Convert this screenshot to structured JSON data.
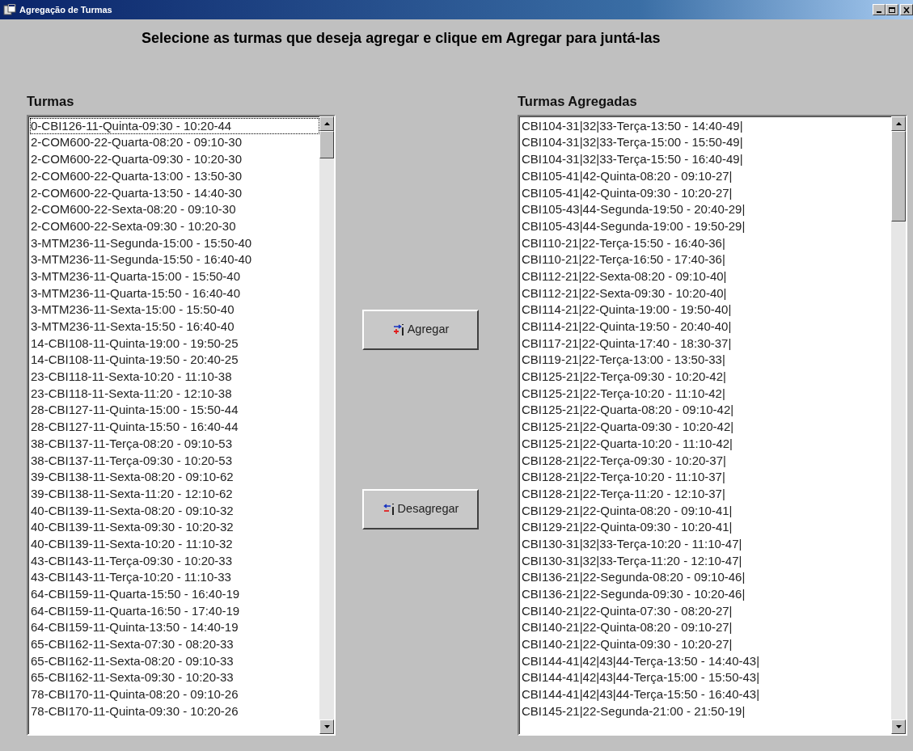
{
  "window": {
    "title": "Agregação de Turmas"
  },
  "instruction": "Selecione as turmas que deseja agregar e clique em Agregar para juntá-las",
  "turmas": {
    "label": "Turmas",
    "items": [
      {
        "text": "0-CBI126-11-Quinta-09:30 - 10:20-44",
        "focused": true
      },
      {
        "text": "2-COM600-22-Quarta-08:20 - 09:10-30",
        "focused": false
      },
      {
        "text": "2-COM600-22-Quarta-09:30 - 10:20-30",
        "focused": false
      },
      {
        "text": "2-COM600-22-Quarta-13:00 - 13:50-30",
        "focused": false
      },
      {
        "text": "2-COM600-22-Quarta-13:50 - 14:40-30",
        "focused": false
      },
      {
        "text": "2-COM600-22-Sexta-08:20 - 09:10-30",
        "focused": false
      },
      {
        "text": "2-COM600-22-Sexta-09:30 - 10:20-30",
        "focused": false
      },
      {
        "text": "3-MTM236-11-Segunda-15:00 - 15:50-40",
        "focused": false
      },
      {
        "text": "3-MTM236-11-Segunda-15:50 - 16:40-40",
        "focused": false
      },
      {
        "text": "3-MTM236-11-Quarta-15:00 - 15:50-40",
        "focused": false
      },
      {
        "text": "3-MTM236-11-Quarta-15:50 - 16:40-40",
        "focused": false
      },
      {
        "text": "3-MTM236-11-Sexta-15:00 - 15:50-40",
        "focused": false
      },
      {
        "text": "3-MTM236-11-Sexta-15:50 - 16:40-40",
        "focused": false
      },
      {
        "text": "14-CBI108-11-Quinta-19:00 - 19:50-25",
        "focused": false
      },
      {
        "text": "14-CBI108-11-Quinta-19:50 - 20:40-25",
        "focused": false
      },
      {
        "text": "23-CBI118-11-Sexta-10:20 - 11:10-38",
        "focused": false
      },
      {
        "text": "23-CBI118-11-Sexta-11:20 - 12:10-38",
        "focused": false
      },
      {
        "text": "28-CBI127-11-Quinta-15:00 - 15:50-44",
        "focused": false
      },
      {
        "text": "28-CBI127-11-Quinta-15:50 - 16:40-44",
        "focused": false
      },
      {
        "text": "38-CBI137-11-Terça-08:20 - 09:10-53",
        "focused": false
      },
      {
        "text": "38-CBI137-11-Terça-09:30 - 10:20-53",
        "focused": false
      },
      {
        "text": "39-CBI138-11-Sexta-08:20 - 09:10-62",
        "focused": false
      },
      {
        "text": "39-CBI138-11-Sexta-11:20 - 12:10-62",
        "focused": false
      },
      {
        "text": "40-CBI139-11-Sexta-08:20 - 09:10-32",
        "focused": false
      },
      {
        "text": "40-CBI139-11-Sexta-09:30 - 10:20-32",
        "focused": false
      },
      {
        "text": "40-CBI139-11-Sexta-10:20 - 11:10-32",
        "focused": false
      },
      {
        "text": "43-CBI143-11-Terça-09:30 - 10:20-33",
        "focused": false
      },
      {
        "text": "43-CBI143-11-Terça-10:20 - 11:10-33",
        "focused": false
      },
      {
        "text": "64-CBI159-11-Quarta-15:50 - 16:40-19",
        "focused": false
      },
      {
        "text": "64-CBI159-11-Quarta-16:50 - 17:40-19",
        "focused": false
      },
      {
        "text": "64-CBI159-11-Quinta-13:50 - 14:40-19",
        "focused": false
      },
      {
        "text": "65-CBI162-11-Sexta-07:30 - 08:20-33",
        "focused": false
      },
      {
        "text": "65-CBI162-11-Sexta-08:20 - 09:10-33",
        "focused": false
      },
      {
        "text": "65-CBI162-11-Sexta-09:30 - 10:20-33",
        "focused": false
      },
      {
        "text": "78-CBI170-11-Quinta-08:20 - 09:10-26",
        "focused": false
      },
      {
        "text": "78-CBI170-11-Quinta-09:30 - 10:20-26",
        "focused": false
      }
    ]
  },
  "buttons": [
    {
      "label": "Agregar",
      "kind": "add"
    },
    {
      "label": "Desagregar",
      "kind": "remove"
    }
  ],
  "agregadas": {
    "label": "Turmas Agregadas",
    "items": [
      "CBI104-31|32|33-Terça-13:50 - 14:40-49|",
      "CBI104-31|32|33-Terça-15:00 - 15:50-49|",
      "CBI104-31|32|33-Terça-15:50 - 16:40-49|",
      "CBI105-41|42-Quinta-08:20 - 09:10-27|",
      "CBI105-41|42-Quinta-09:30 - 10:20-27|",
      "CBI105-43|44-Segunda-19:50 - 20:40-29|",
      "CBI105-43|44-Segunda-19:00 - 19:50-29|",
      "CBI110-21|22-Terça-15:50 - 16:40-36|",
      "CBI110-21|22-Terça-16:50 - 17:40-36|",
      "CBI112-21|22-Sexta-08:20 - 09:10-40|",
      "CBI112-21|22-Sexta-09:30 - 10:20-40|",
      "CBI114-21|22-Quinta-19:00 - 19:50-40|",
      "CBI114-21|22-Quinta-19:50 - 20:40-40|",
      "CBI117-21|22-Quinta-17:40 - 18:30-37|",
      "CBI119-21|22-Terça-13:00 - 13:50-33|",
      "CBI125-21|22-Terça-09:30 - 10:20-42|",
      "CBI125-21|22-Terça-10:20 - 11:10-42|",
      "CBI125-21|22-Quarta-08:20 - 09:10-42|",
      "CBI125-21|22-Quarta-09:30 - 10:20-42|",
      "CBI125-21|22-Quarta-10:20 - 11:10-42|",
      "CBI128-21|22-Terça-09:30 - 10:20-37|",
      "CBI128-21|22-Terça-10:20 - 11:10-37|",
      "CBI128-21|22-Terça-11:20 - 12:10-37|",
      "CBI129-21|22-Quinta-08:20 - 09:10-41|",
      "CBI129-21|22-Quinta-09:30 - 10:20-41|",
      "CBI130-31|32|33-Terça-10:20 - 11:10-47|",
      "CBI130-31|32|33-Terça-11:20 - 12:10-47|",
      "CBI136-21|22-Segunda-08:20 - 09:10-46|",
      "CBI136-21|22-Segunda-09:30 - 10:20-46|",
      "CBI140-21|22-Quinta-07:30 - 08:20-27|",
      "CBI140-21|22-Quinta-08:20 - 09:10-27|",
      "CBI140-21|22-Quinta-09:30 - 10:20-27|",
      "CBI144-41|42|43|44-Terça-13:50 - 14:40-43|",
      "CBI144-41|42|43|44-Terça-15:00 - 15:50-43|",
      "CBI144-41|42|43|44-Terça-15:50 - 16:40-43|",
      "CBI145-21|22-Segunda-21:00 - 21:50-19|"
    ]
  }
}
